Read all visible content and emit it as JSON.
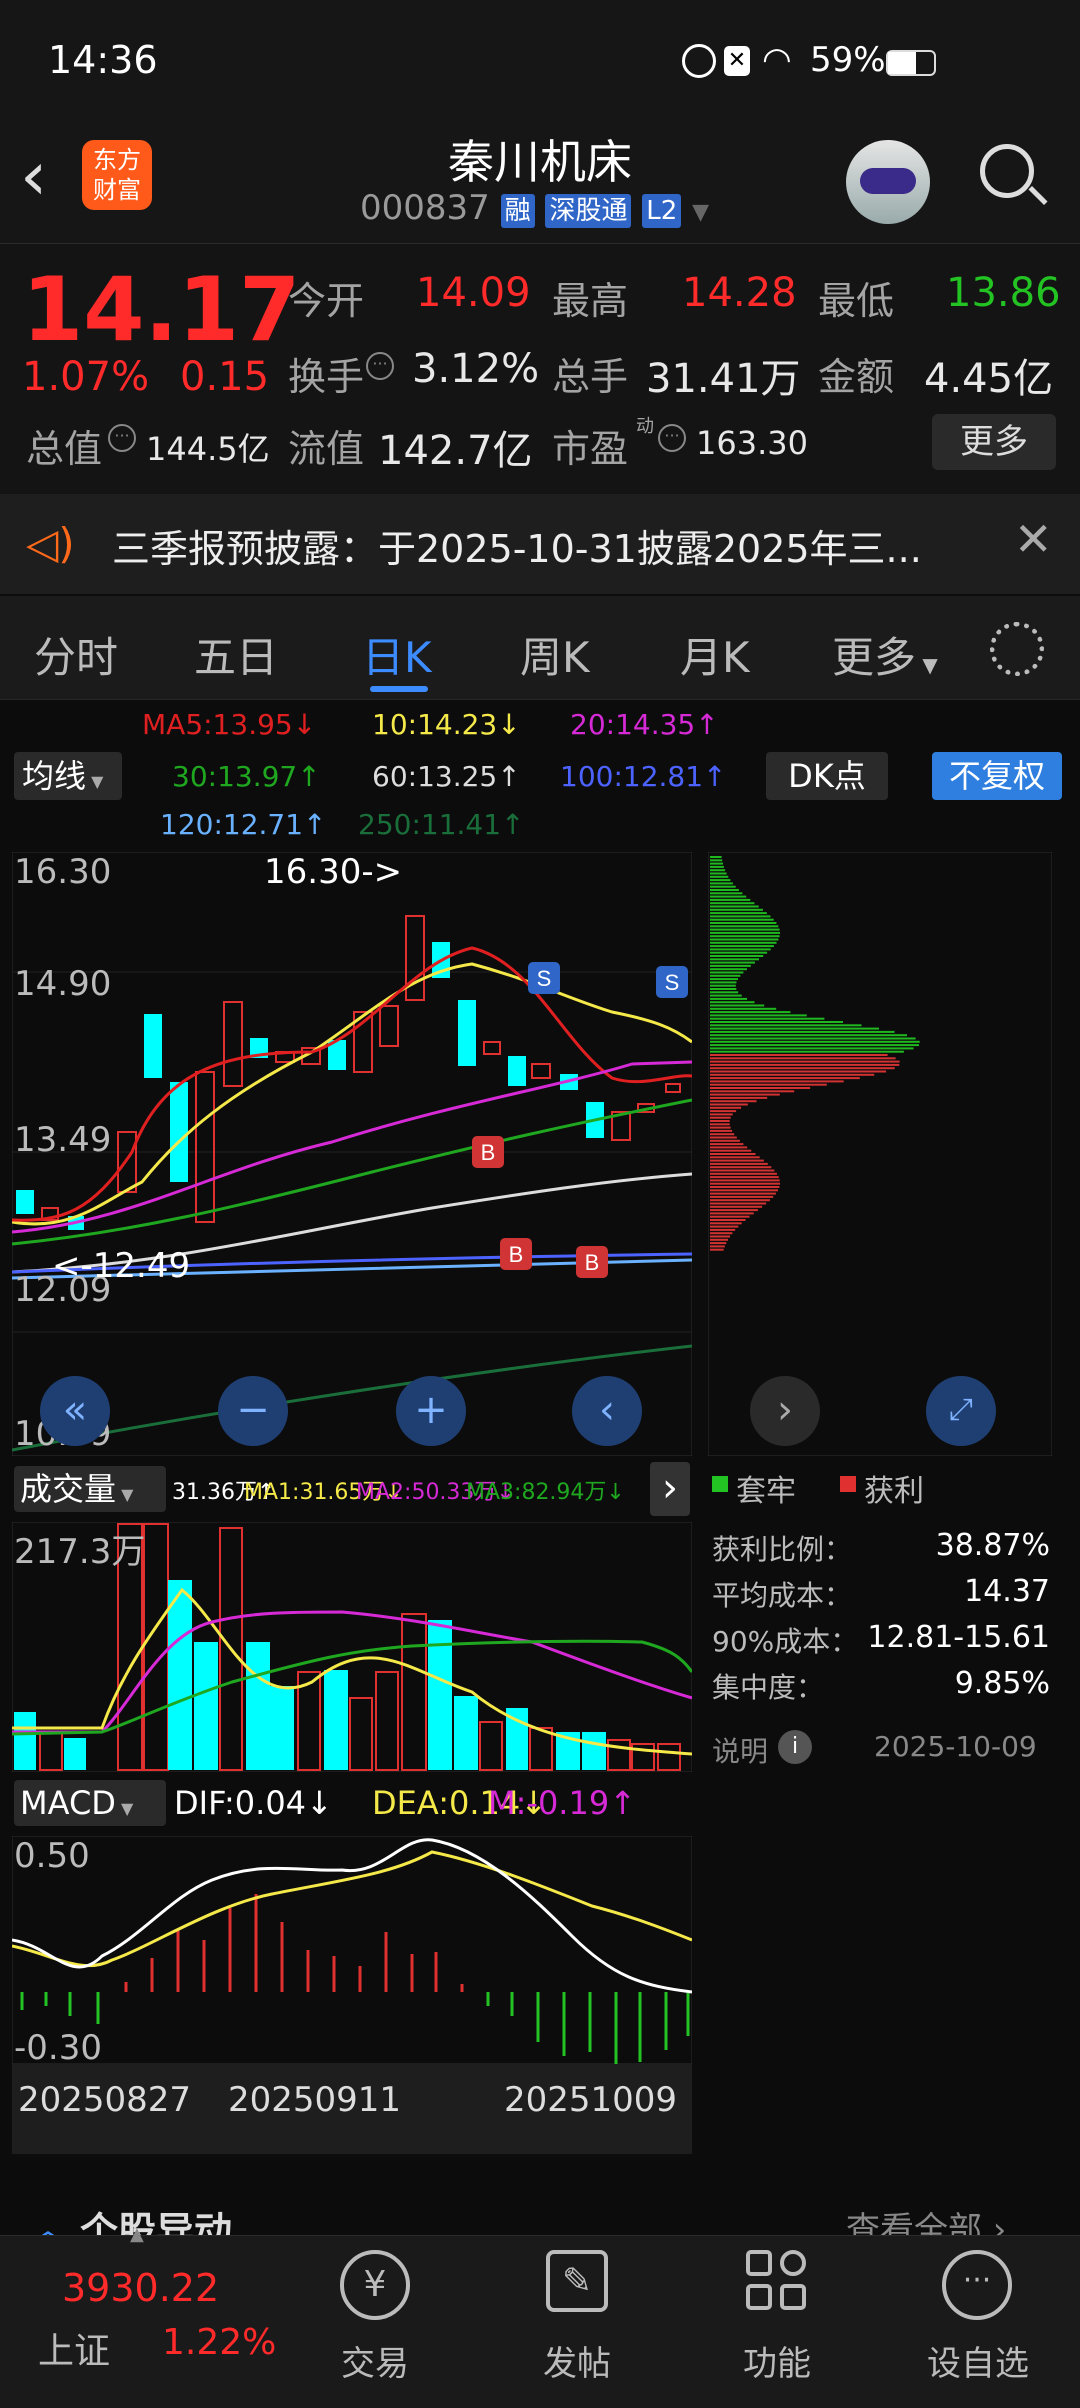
{
  "status": {
    "time": "14:36",
    "battery": "59%"
  },
  "header": {
    "logo_line1": "东方",
    "logo_line2": "财富",
    "title": "秦川机床",
    "code": "000837",
    "tag_rong": "融",
    "tag_sgt": "深股通",
    "tag_l2": "L2"
  },
  "quote": {
    "price": "14.17",
    "change_pct": "1.07%",
    "change_amt": "0.15",
    "open_label": "今开",
    "open": "14.09",
    "high_label": "最高",
    "high": "14.28",
    "low_label": "最低",
    "low": "13.86",
    "turnover_label": "换手",
    "turnover": "3.12%",
    "volume_label": "总手",
    "volume": "31.41万",
    "amount_label": "金额",
    "amount": "4.45亿",
    "mktcap_label": "总值",
    "mktcap": "144.5亿",
    "float_label": "流值",
    "float": "142.7亿",
    "pe_label": "市盈",
    "pe_sup": "动",
    "pe": "163.30",
    "more": "更多"
  },
  "notice": {
    "text": "三季报预披露：于2025-10-31披露2025年三..."
  },
  "tabs": [
    {
      "label": "分时"
    },
    {
      "label": "五日"
    },
    {
      "label": "日K"
    },
    {
      "label": "周K"
    },
    {
      "label": "月K"
    },
    {
      "label": "更多"
    }
  ],
  "ma": {
    "ma5": "MA5:13.95↓",
    "ma10": "10:14.23↓",
    "ma20": "20:14.35↑",
    "ma30": "30:13.97↑",
    "ma60": "60:13.25↑",
    "ma100": "100:12.81↑",
    "ma120": "120:12.71↑",
    "ma250": "250:11.41↑",
    "selector": "均线",
    "dk": "DK点",
    "fq": "不复权"
  },
  "kline": {
    "y_labels": [
      "16.30",
      "14.90",
      "13.49",
      "12.09",
      "10.69"
    ],
    "high_mark": "16.30->",
    "low_mark": "<-12.49"
  },
  "colors": {
    "up": "#ff2a2a",
    "down": "#22c322",
    "accent": "#2f7fe0",
    "ma5": "#e02020",
    "ma10": "#f5e94a",
    "ma20": "#d62ad6",
    "ma30": "#1fa81f",
    "ma60": "#dddddd",
    "ma100": "#4c63ff",
    "ma120": "#6ab2ff"
  },
  "volume": {
    "selector": "成交量",
    "v": "31.36万↑",
    "ma1": "MA1:31.65万↓",
    "ma2": "MA2:50.33万↓",
    "ma3": "MA3:82.94万↓",
    "max_label": "217.3万"
  },
  "macd": {
    "selector": "MACD",
    "dif": "DIF:0.04↓",
    "dea": "DEA:0.14↓",
    "m": "M:-0.19↑",
    "top": "0.50",
    "bottom": "-0.30"
  },
  "dates": [
    "20250827",
    "20250911",
    "20251009"
  ],
  "chip": {
    "legend_trap": "套牢",
    "legend_profit": "获利",
    "rows": [
      {
        "k": "获利比例：",
        "v": "38.87%"
      },
      {
        "k": "平均成本：",
        "v": "14.37"
      },
      {
        "k": "90%成本：",
        "v": "12.81-15.61"
      },
      {
        "k": "集中度：",
        "v": "9.85%"
      }
    ],
    "note": "说明",
    "date": "2025-10-09"
  },
  "section": {
    "title": "个股异动",
    "more": "查看全部"
  },
  "nav": {
    "index_value": "3930.22",
    "index_name": "上证",
    "index_pct": "1.22%",
    "trade": "交易",
    "post": "发帖",
    "func": "功能",
    "watch": "设自选"
  }
}
